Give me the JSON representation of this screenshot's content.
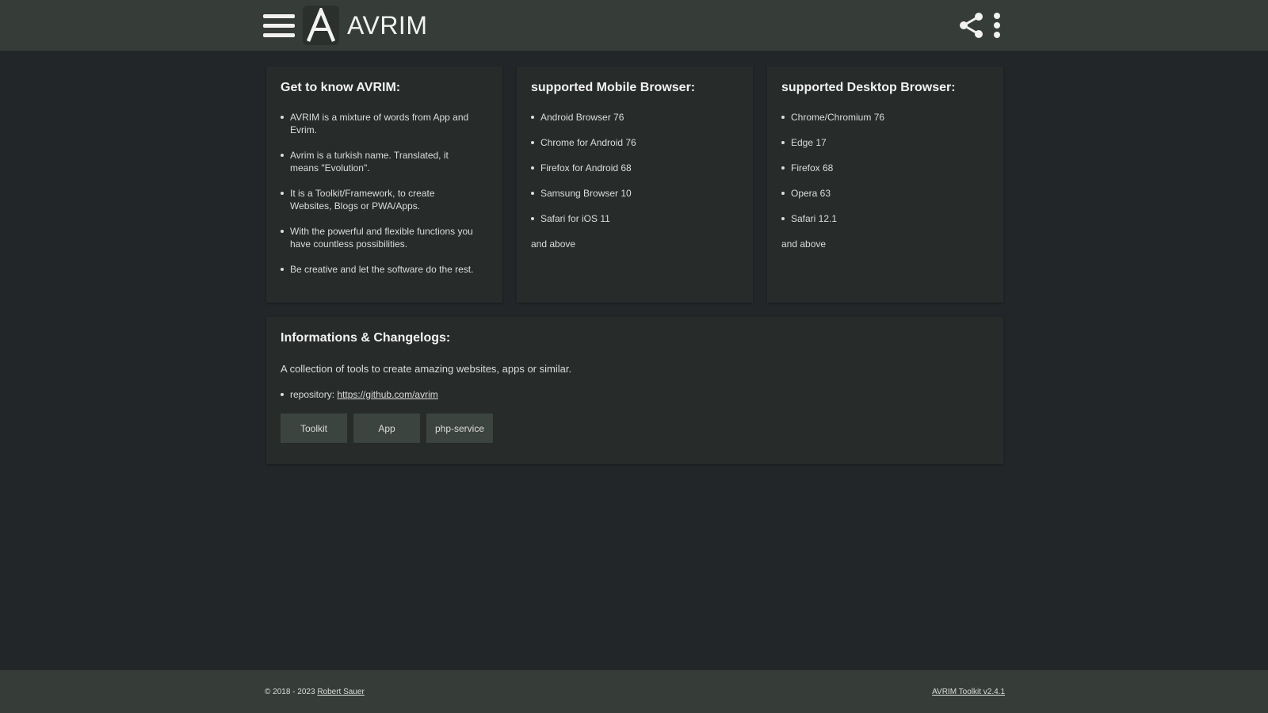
{
  "header": {
    "app_title": "AVRIM",
    "logo_letter": "A"
  },
  "cards": {
    "about": {
      "title": "Get to know AVRIM:",
      "items": [
        "AVRIM is a mixture of words from App and Evrim.",
        "Avrim is a turkish name. Translated, it means \"Evolution\".",
        "It is a Toolkit/Framework, to create Websites, Blogs or PWA/Apps.",
        "With the powerful and flexible functions you have countless possibilities.",
        "Be creative and let the software do the rest."
      ]
    },
    "mobile": {
      "title": "supported Mobile Browser:",
      "items": [
        "Android Browser 76",
        "Chrome for Android 76",
        "Firefox for Android 68",
        "Samsung Browser 10",
        "Safari for iOS 11"
      ],
      "footer": "and above"
    },
    "desktop": {
      "title": "supported Desktop Browser:",
      "items": [
        "Chrome/Chromium 76",
        "Edge 17",
        "Firefox 68",
        "Opera 63",
        "Safari 12.1"
      ],
      "footer": "and above"
    },
    "info": {
      "title": "Informations & Changelogs:",
      "description": "A collection of tools to create amazing websites, apps or similar.",
      "repo_label": "repository:",
      "repo_link": "https://github.com/avrim",
      "buttons": [
        "Toolkit",
        "App",
        "php-service"
      ]
    }
  },
  "footer": {
    "copyright": "© 2018 - 2023",
    "author": "Robert Sauer",
    "version_link": "AVRIM Toolkit v2.4.1"
  },
  "colors": {
    "page_bg": "#232629",
    "bar_bg": "#363d38",
    "card_bg": "#272b2a",
    "button_bg": "#3b443e"
  }
}
